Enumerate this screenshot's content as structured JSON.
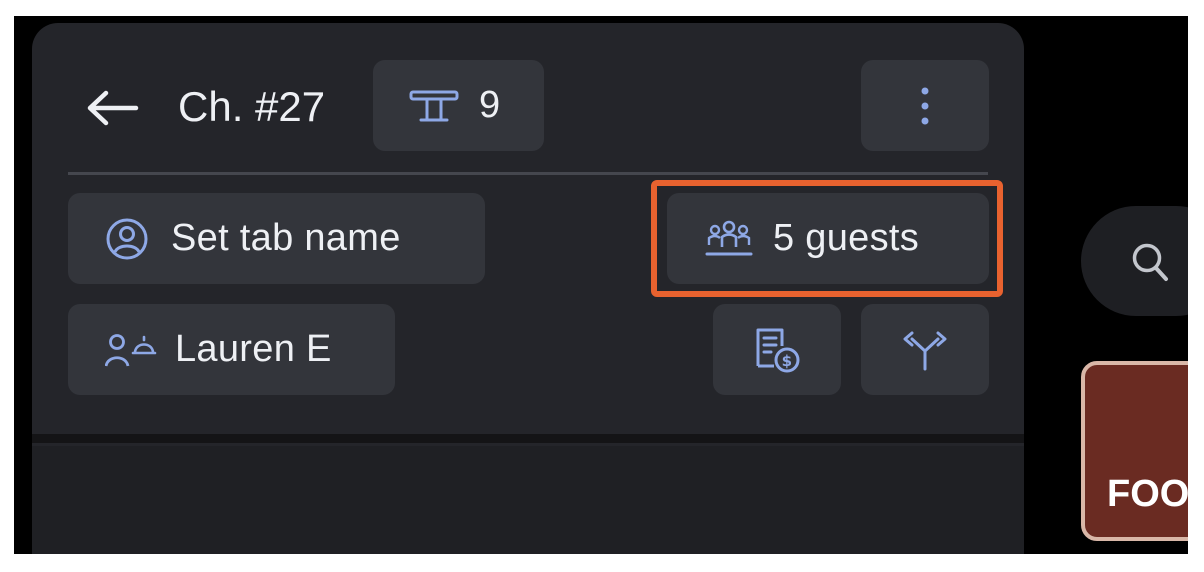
{
  "header": {
    "title": "Ch. #27",
    "table_number": "9"
  },
  "tab_name_button": {
    "label": "Set tab name"
  },
  "guests_button": {
    "label": "5 guests"
  },
  "server_button": {
    "label": "Lauren E"
  },
  "right_panel": {
    "card_label": "FOO"
  },
  "colors": {
    "panel_background": "#24252a",
    "chip_background": "#33353b",
    "icon_accent": "#8ea8e6",
    "highlight": "#e8622f",
    "food_card": "#6a2b22"
  },
  "icons": [
    "back-arrow-icon",
    "table-icon",
    "more-vertical-icon",
    "user-circle-icon",
    "guests-icon",
    "server-icon",
    "receipt-dollar-icon",
    "split-arrows-icon",
    "search-icon"
  ]
}
